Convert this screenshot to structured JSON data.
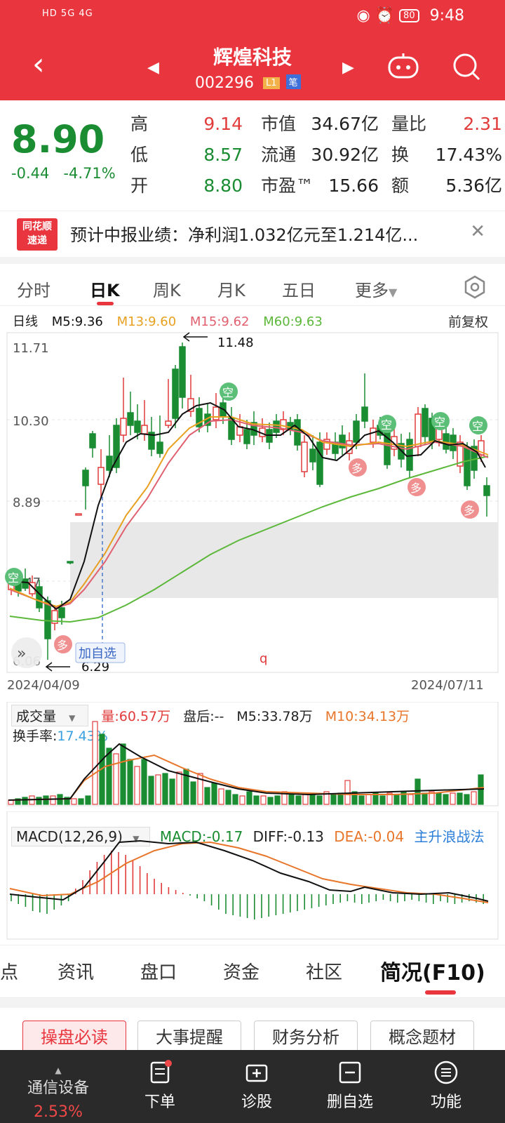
{
  "status_bar": {
    "left": "HD 5G 4G",
    "battery": "80",
    "time": "9:48"
  },
  "header": {
    "stock_name": "辉煌科技",
    "stock_code": "002296",
    "badge_level": "L1",
    "badge_bi": "笔"
  },
  "quote": {
    "price": "8.90",
    "change": "-0.44",
    "change_pct": "-4.71%",
    "high_label": "高",
    "high": "9.14",
    "low_label": "低",
    "low": "8.57",
    "open_label": "开",
    "open": "8.80",
    "mcap_label": "市值",
    "mcap": "34.67亿",
    "float_label": "流通",
    "float": "30.92亿",
    "pe_label": "市盈™",
    "pe": "15.66",
    "vr_label": "量比",
    "vr": "2.31",
    "turnover_label": "换",
    "turnover": "17.43%",
    "amount_label": "额",
    "amount": "5.36亿"
  },
  "news": {
    "logo_line1": "同花顺",
    "logo_line2": "速递",
    "text": "预计中报业绩：净利润1.032亿元至1.214亿..."
  },
  "chart_tabs": [
    "分时",
    "日K",
    "周K",
    "月K",
    "五日",
    "更多"
  ],
  "ma_legend": {
    "period": "日线",
    "m5": "M5:9.36",
    "m13": "M13:9.60",
    "m15": "M15:9.62",
    "m60": "M60:9.63",
    "adj": "前复权"
  },
  "kline_labels": {
    "y_top": "11.71",
    "y_mid1": "10.30",
    "y_mid2": "8.89",
    "y_mid3": "7.47",
    "y_bottom": "6.06",
    "max_mark": "11.48",
    "min_mark": "6.29",
    "date_start": "2024/04/09",
    "date_end": "2024/07/11",
    "add_watch": "加自选",
    "empty_tag": "空",
    "long_tag": "多"
  },
  "volume": {
    "select": "成交量",
    "vol": "量:60.57万",
    "after": "盘后:--",
    "m5": "M5:33.78万",
    "m10": "M10:34.13万",
    "turnover_label": "换手率:",
    "turnover": "17.43%"
  },
  "macd": {
    "select": "MACD(12,26,9)",
    "macd": "MACD:-0.17",
    "diff": "DIFF:-0.13",
    "dea": "DEA:-0.04",
    "strategy": "主升浪战法"
  },
  "bottom_tabs": [
    "点",
    "资讯",
    "盘口",
    "资金",
    "社区",
    "简况(F10)"
  ],
  "chips": [
    "操盘必读",
    "大事提醒",
    "财务分析",
    "概念题材"
  ],
  "bottom_bar": {
    "industry": "通信设备",
    "industry_pct": "2.53%",
    "order": "下单",
    "diagnose": "诊股",
    "remove_watch": "删自选",
    "function": "功能"
  },
  "colors": {
    "header": "#e8353e",
    "up": "#e13b3b",
    "down": "#1a8c32",
    "m5": "#111111",
    "m13": "#e8a020",
    "m15": "#e06070",
    "m60": "#5cb83a"
  },
  "chart_data": {
    "type": "candlestick",
    "x_range": [
      "2024/04/09",
      "2024/07/11"
    ],
    "y_ticks": [
      11.71,
      10.3,
      8.89,
      7.47,
      6.06
    ],
    "ylim": [
      6.06,
      11.71
    ],
    "annotated_high": 11.48,
    "annotated_low": 6.29,
    "last_close": 8.9
  }
}
